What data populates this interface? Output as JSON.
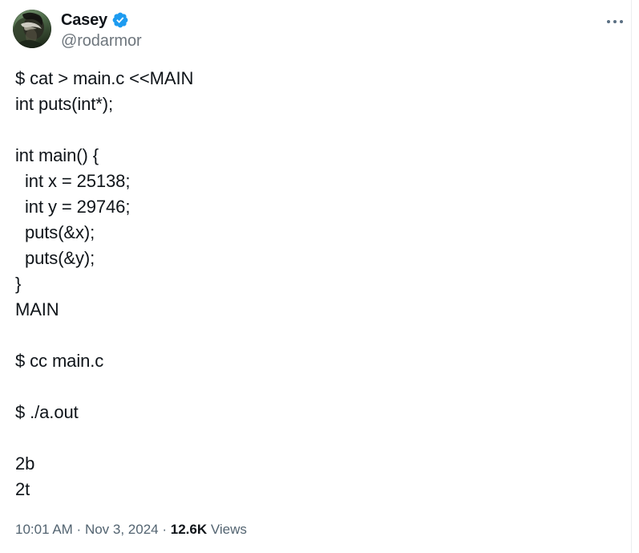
{
  "tweet": {
    "author": {
      "display_name": "Casey",
      "handle": "@rodarmor",
      "verified": true,
      "verified_badge_color": "#1d9bf0",
      "avatar_icon": "user-avatar-photo"
    },
    "more_menu_icon": "ellipsis-horizontal-icon",
    "body_lines": [
      "$ cat > main.c <<MAIN",
      "int puts(int*);",
      "",
      "int main() {",
      "  int x = 25138;",
      "  int y = 29746;",
      "  puts(&x);",
      "  puts(&y);",
      "}",
      "MAIN",
      "",
      "$ cc main.c",
      "",
      "$ ./a.out",
      "",
      "2b",
      "2t"
    ],
    "footer": {
      "time": "10:01 AM",
      "separator_1": " · ",
      "date": "Nov 3, 2024",
      "separator_2": " · ",
      "views_count": "12.6K",
      "views_label": " Views"
    }
  },
  "colors": {
    "text_primary": "#0f1419",
    "text_secondary": "#536471",
    "handle_gray": "#6e767d",
    "accent_blue": "#1d9bf0",
    "background": "#ffffff",
    "divider": "#eceef0"
  }
}
